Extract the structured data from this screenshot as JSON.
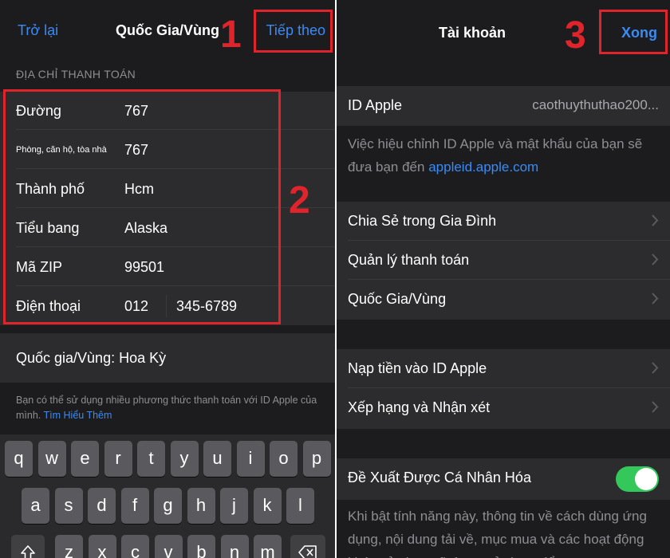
{
  "left": {
    "nav": {
      "back": "Trở lại",
      "title": "Quốc Gia/Vùng",
      "next": "Tiếp theo"
    },
    "section_header": "ĐỊA CHỈ THANH TOÁN",
    "form": [
      {
        "label": "Đường",
        "value": "767"
      },
      {
        "label": "Phòng, căn hộ, tòa nhà",
        "value": "767"
      },
      {
        "label": "Thành phố",
        "value": "Hcm"
      },
      {
        "label": "Tiểu bang",
        "value": "Alaska"
      },
      {
        "label": "Mã ZIP",
        "value": "99501"
      },
      {
        "label": "Điện thoại",
        "value": "012",
        "value2": "345-6789"
      }
    ],
    "country": "Quốc gia/Vùng: Hoa Kỳ",
    "footnote": "Bạn có thể sử dụng nhiều phương thức thanh toán với ID Apple của mình.",
    "footnote_link": "Tìm Hiểu Thêm",
    "keyboard": {
      "row1": [
        "q",
        "w",
        "e",
        "r",
        "t",
        "y",
        "u",
        "i",
        "o",
        "p"
      ],
      "row2": [
        "a",
        "s",
        "d",
        "f",
        "g",
        "h",
        "j",
        "k",
        "l"
      ],
      "row3": [
        "z",
        "x",
        "c",
        "v",
        "b",
        "n",
        "m"
      ]
    },
    "annotations": [
      "1",
      "2"
    ]
  },
  "right": {
    "nav": {
      "title": "Tài khoản",
      "done": "Xong"
    },
    "apple_id": {
      "label": "ID Apple",
      "value": "caothuythuthao200..."
    },
    "desc_text": "Việc hiệu chỉnh ID Apple và mật khẩu của bạn sẽ đưa bạn đến",
    "desc_link": "appleid.apple.com",
    "group1": [
      "Chia Sẻ trong Gia Đình",
      "Quản lý thanh toán",
      "Quốc Gia/Vùng"
    ],
    "group2": [
      "Nạp tiền vào ID Apple",
      "Xếp hạng và Nhận xét"
    ],
    "personalized": {
      "label": "Đề Xuất Được Cá Nhân Hóa",
      "enabled": true
    },
    "personalized_desc": "Khi bật tính năng này, thông tin về cách dùng ứng dụng, nội dung tải về, mục mua và các hoạt động khác của bạn sẽ được sử dụng để",
    "annotation": "3"
  },
  "colors": {
    "accent": "#3a8bf5",
    "annotation": "#e0242b",
    "toggle_on": "#34c759"
  },
  "icons": {
    "chevron": "chevron-right-icon",
    "shift": "shift-icon",
    "backspace": "backspace-icon"
  }
}
